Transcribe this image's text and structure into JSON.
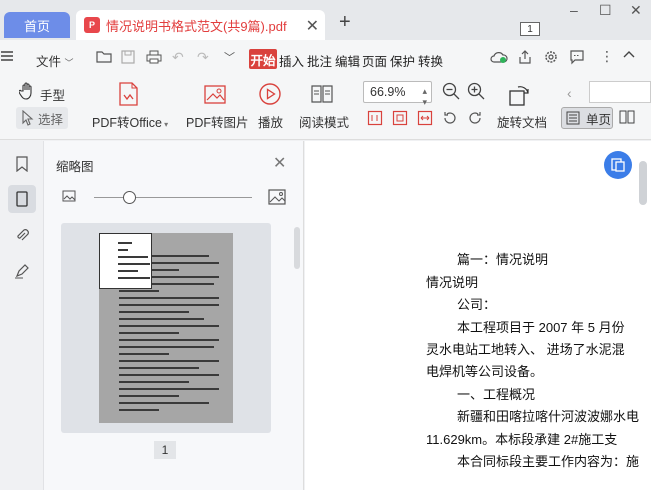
{
  "tabbar": {
    "home_label": "首页",
    "doc_title": "情况说明书格式范文(共9篇).pdf",
    "pdf_badge": "P",
    "window_count": "1"
  },
  "menu": {
    "file_label": "文件",
    "tabs": [
      "开始",
      "插入",
      "批注",
      "编辑",
      "页面",
      "保护",
      "转换"
    ]
  },
  "ribbon": {
    "hand_tool": "手型",
    "select_tool": "选择",
    "pdf_to_office": "PDF转Office",
    "pdf_to_image": "PDF转图片",
    "play": "播放",
    "read_mode": "阅读模式",
    "zoom_value": "66.9%",
    "rotate_doc": "旋转文档",
    "single_page": "单页"
  },
  "thumbnail_panel": {
    "title": "缩略图",
    "page_number": "1",
    "zoom_level": 0.23
  },
  "document": {
    "lines": [
      "篇一：情况说明",
      "情况说明",
      "公司：",
      "本工程项目于 2007 年 5 月份",
      "灵水电站工地转入、 进场了水泥混",
      "电焊机等公司设备。",
      "一、工程概况",
      "新疆和田喀拉喀什河波波娜水电",
      "11.629km。本标段承建 2#施工支",
      "本合同标段主要工作内容为：施"
    ]
  },
  "colors": {
    "accent": "#6d8de8",
    "start_red": "#d9423d",
    "title_red": "#e23d3d",
    "float_blue": "#3b7de8"
  }
}
